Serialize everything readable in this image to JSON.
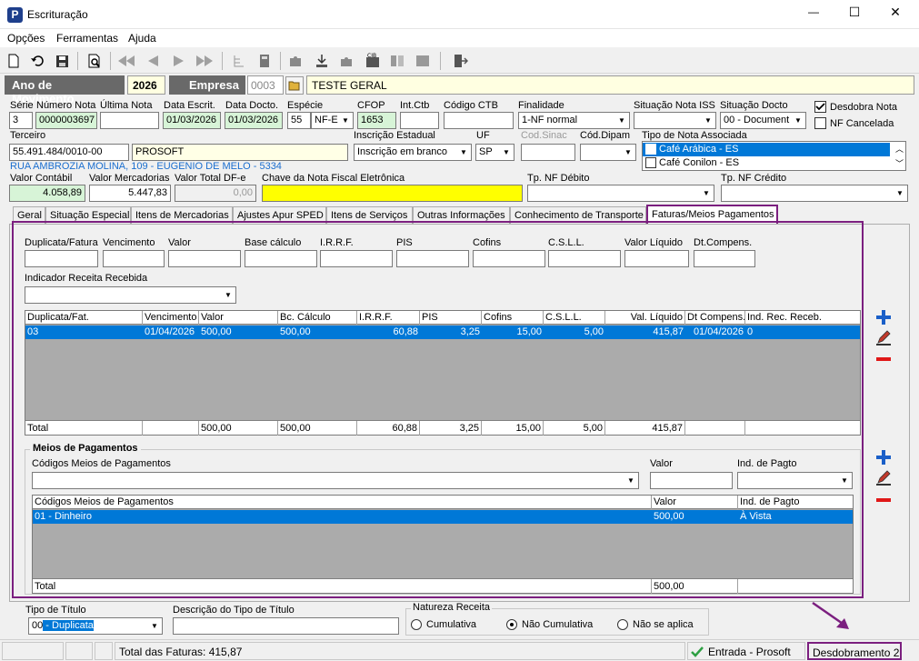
{
  "window": {
    "title": "Escrituração",
    "controls": {
      "minimize": "—",
      "maximize": "☐",
      "close": "✕"
    }
  },
  "menu": [
    "Opções",
    "Ferramentas",
    "Ajuda"
  ],
  "header": {
    "ano_label": "Ano de Movimento",
    "ano_value": "2026",
    "empresa_label": "Empresa",
    "empresa_code": "0003",
    "empresa_name": "TESTE GERAL"
  },
  "fields": {
    "serie": {
      "label": "Série",
      "value": "3"
    },
    "numero_nota": {
      "label": "Número Nota",
      "value": "0000003697"
    },
    "ultima_nota": {
      "label": "Última Nota",
      "value": ""
    },
    "data_escrit": {
      "label": "Data Escrit.",
      "value": "01/03/2026"
    },
    "data_docto": {
      "label": "Data Docto.",
      "value": "01/03/2026"
    },
    "especie": {
      "label": "Espécie",
      "code": "55",
      "value": "NF-E"
    },
    "cfop": {
      "label": "CFOP",
      "value": "1653"
    },
    "int_ctb": {
      "label": "Int.Ctb",
      "value": ""
    },
    "codigo_ctb": {
      "label": "Código CTB",
      "value": ""
    },
    "finalidade": {
      "label": "Finalidade",
      "value": "1-NF normal"
    },
    "situacao_iss": {
      "label": "Situação Nota ISS",
      "value": ""
    },
    "situacao_docto": {
      "label": "Situação Docto",
      "value": "00 - Document"
    },
    "desdobra_nota": {
      "label": "Desdobra Nota",
      "checked": true
    },
    "nf_cancelada": {
      "label": "NF Cancelada",
      "checked": false
    },
    "terceiro": {
      "label": "Terceiro",
      "value": "55.491.484/0010-00",
      "name": "PROSOFT"
    },
    "inscricao": {
      "label": "Inscrição Estadual",
      "value": "Inscrição em branco"
    },
    "uf": {
      "label": "UF",
      "value": "SP"
    },
    "cod_sinac": {
      "label": "Cod.Sinac",
      "value": ""
    },
    "cod_dipam": {
      "label": "Cód.Dipam",
      "value": ""
    },
    "tipo_nota_assoc": {
      "label": "Tipo de Nota Associada",
      "items": [
        {
          "label": "Café Arábica - ES",
          "selected": true
        },
        {
          "label": "Café Conilon - ES",
          "selected": false
        }
      ]
    },
    "address": "RUA AMBROZIA MOLINA, 109 - EUGENIO DE MELO - 5334",
    "valor_contabil": {
      "label": "Valor Contábil",
      "value": "4.058,89"
    },
    "valor_mercadorias": {
      "label": "Valor Mercadorias",
      "value": "5.447,83"
    },
    "valor_total_dfe": {
      "label": "Valor Total DF-e",
      "value": "0,00"
    },
    "chave_nfe": {
      "label": "Chave da Nota Fiscal Eletrônica",
      "value": ""
    },
    "tp_nf_debito": {
      "label": "Tp. NF Débito",
      "value": ""
    },
    "tp_nf_credito": {
      "label": "Tp. NF Crédito",
      "value": ""
    }
  },
  "tabs": [
    {
      "label": "Geral"
    },
    {
      "label": "Situação Especial"
    },
    {
      "label": "Itens de Mercadorias"
    },
    {
      "label": "Ajustes Apur SPED"
    },
    {
      "label": "Itens de Serviços"
    },
    {
      "label": "Outras Informações"
    },
    {
      "label": "Conhecimento de Transporte"
    },
    {
      "label": "Faturas/Meios Pagamentos",
      "active": true
    }
  ],
  "faturas": {
    "input_labels": [
      "Duplicata/Fatura",
      "Vencimento",
      "Valor",
      "Base cálculo",
      "I.R.R.F.",
      "PIS",
      "Cofins",
      "C.S.L.L.",
      "Valor Líquido",
      "Dt.Compens."
    ],
    "indicador_label": "Indicador Receita Recebida",
    "indicador_value": "",
    "grid_headers": [
      "Duplicata/Fat.",
      "Vencimento",
      "Valor",
      "Bc. Cálculo",
      "I.R.R.F.",
      "PIS",
      "Cofins",
      "C.S.L.L.",
      "Val. Líquido",
      "Dt Compens.",
      "Ind. Rec. Receb."
    ],
    "rows": [
      [
        "03",
        "01/04/2026",
        "500,00",
        "500,00",
        "60,88",
        "3,25",
        "15,00",
        "5,00",
        "415,87",
        "01/04/2026",
        "0"
      ]
    ],
    "totals": [
      "Total",
      "",
      "500,00",
      "500,00",
      "60,88",
      "3,25",
      "15,00",
      "5,00",
      "415,87",
      "",
      ""
    ]
  },
  "meios": {
    "group_title": "Meios de Pagamentos",
    "codigos_label": "Códigos Meios de Pagamentos",
    "valor_label": "Valor",
    "ind_pagto_label": "Ind. de Pagto",
    "grid_headers": [
      "Códigos Meios de Pagamentos",
      "Valor",
      "Ind. de Pagto"
    ],
    "rows": [
      [
        "01 - Dinheiro",
        "500,00",
        "À Vista"
      ]
    ],
    "totals": [
      "Total",
      "500,00",
      ""
    ]
  },
  "footer": {
    "tipo_titulo_label": "Tipo de Título",
    "tipo_titulo_code": "00",
    "tipo_titulo_value": " - Duplicata",
    "desc_tipo_label": "Descrição do Tipo de Título",
    "natureza_label": "Natureza Receita",
    "natureza_options": [
      {
        "label": "Cumulativa",
        "checked": false
      },
      {
        "label": "Não Cumulativa",
        "checked": true
      },
      {
        "label": "Não se aplica",
        "checked": false
      }
    ]
  },
  "status": {
    "total_faturas": "Total das Faturas: 415,87",
    "entrada": "Entrada - Prosoft",
    "desdobramento": "Desdobramento 2"
  },
  "colors": {
    "selection": "#0078d7",
    "highlight_border": "#7b1f7f",
    "add_icon": "#1a5fc8",
    "remove_icon": "#e01818"
  }
}
